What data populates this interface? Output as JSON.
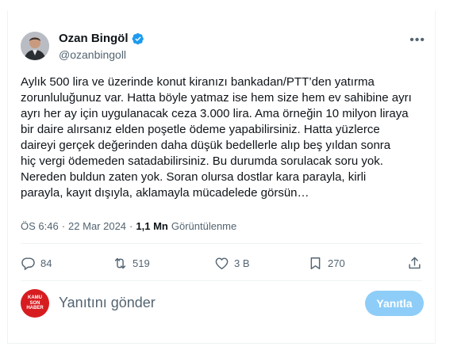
{
  "author": {
    "name": "Ozan Bingöl",
    "handle": "@ozanbingoll",
    "verified_icon": "verified-badge-icon"
  },
  "tweet": {
    "text": "Aylık 500 lira ve üzerinde konut kiranızı bankadan/PTT’den yatırma\nzorunluluğunuz var. Hatta böyle yatmaz ise hem size hem ev sahibine ayrı\nayrı her ay için uygulanacak ceza 3.000 lira. Ama örneğin 10 milyon liraya\nbir daire alırsanız elden poşetle ödeme yapabilirsiniz. Hatta yüzlerce\ndaireyi gerçek değerinden daha düşük bedellerle alıp beş yıldan sonra\nhiç vergi ödemeden satadabilirsiniz. Bu durumda sorulacak soru yok.\nNereden buldun zaten yok. Soran olursa dostlar kara parayla, kirli\nparayla, kayıt dışıyla, aklamayla mücadelede görsün…"
  },
  "meta": {
    "time": "ÖS 6:46",
    "separator": "·",
    "date": "22 Mar 2024",
    "views_count": "1,1 Mn",
    "views_label": "Görüntülenme"
  },
  "actions": {
    "replies": "84",
    "retweets": "519",
    "likes": "3 B",
    "bookmarks": "270"
  },
  "reply": {
    "placeholder": "Yanıtını gönder",
    "button_label": "Yanıtla",
    "avatar_logo_text": "KAMU SON HABER"
  },
  "colors": {
    "text_primary": "#0f1419",
    "text_secondary": "#536471",
    "verified_blue": "#1d9bf0",
    "reply_button": "#8ecdf8",
    "avatar_red": "#d71c20"
  }
}
